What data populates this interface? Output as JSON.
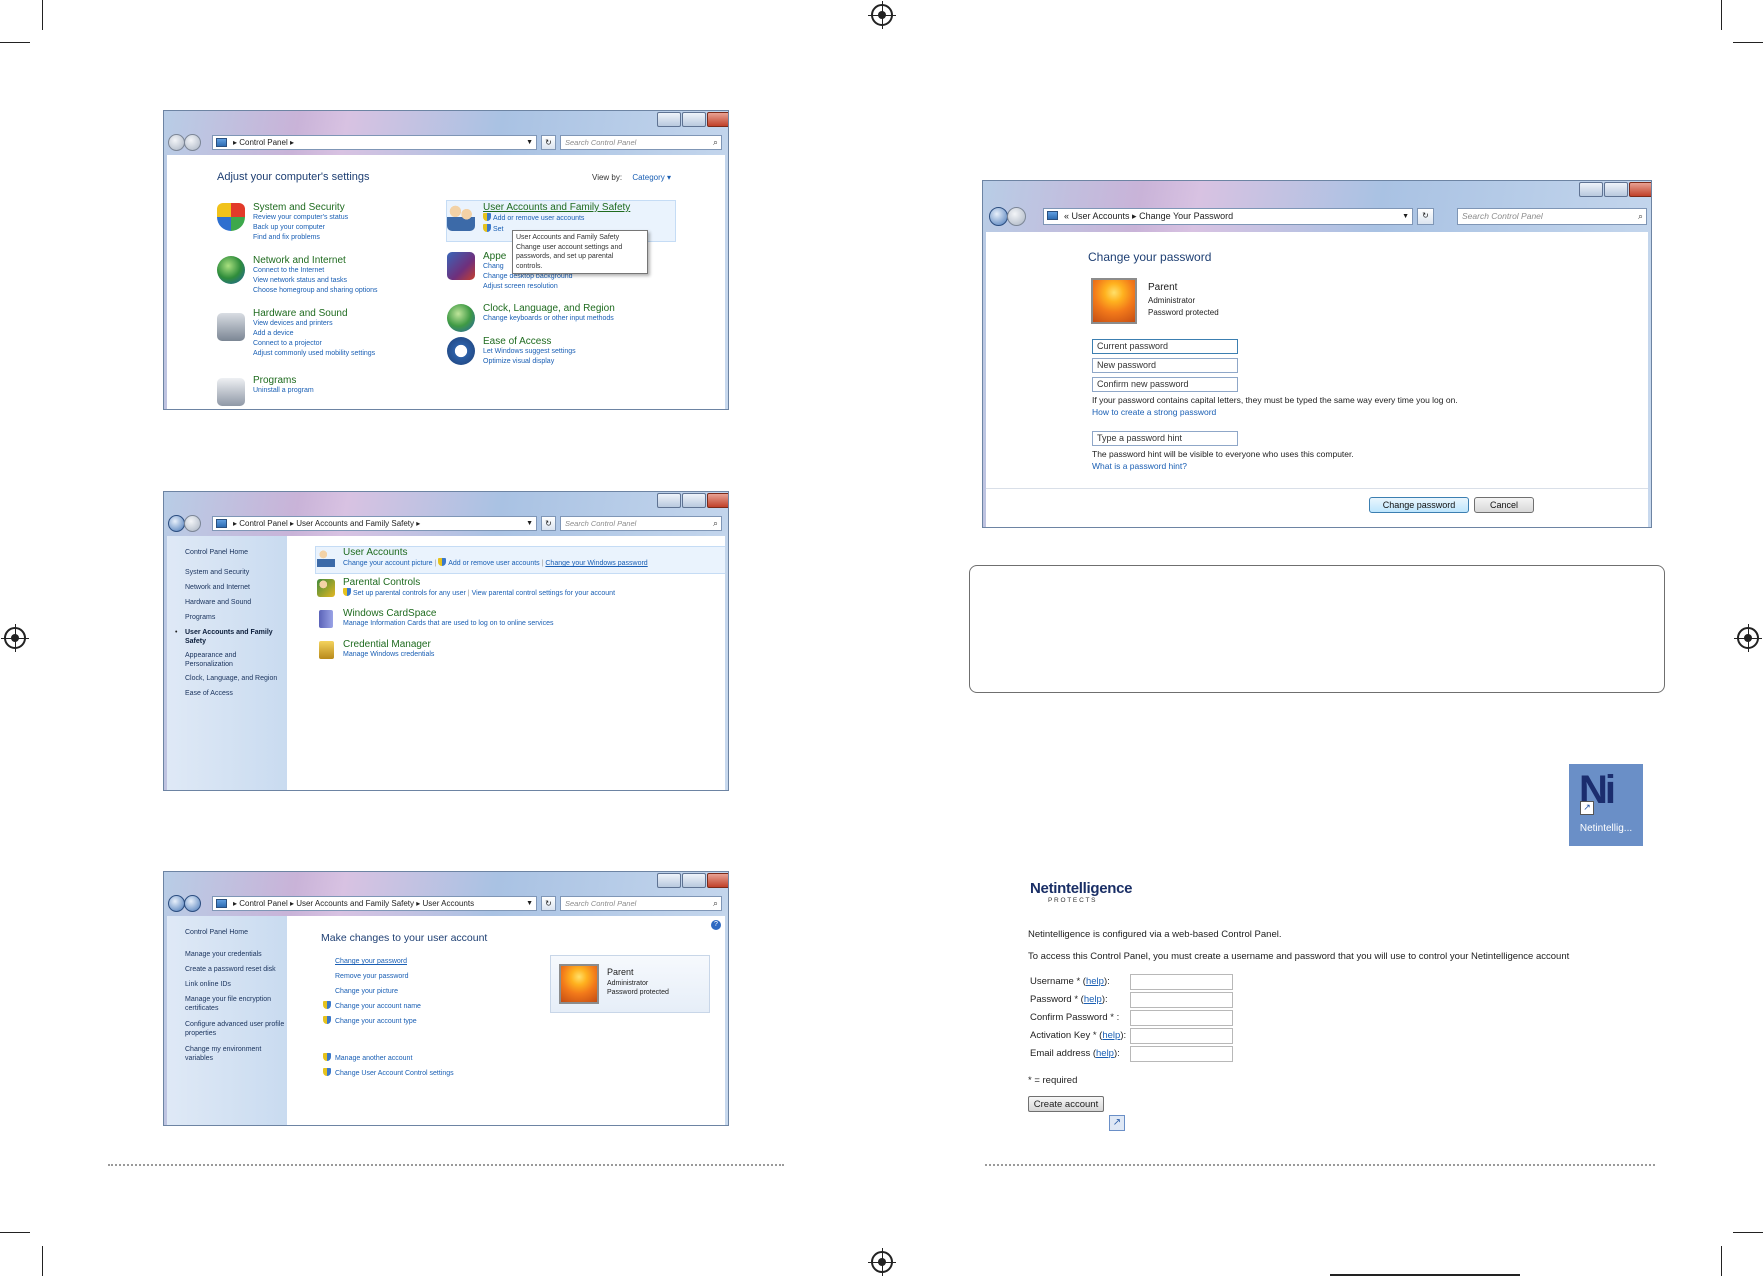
{
  "win1": {
    "address": {
      "crumbs": [
        "Control Panel"
      ]
    },
    "search_placeholder": "Search Control Panel",
    "heading": "Adjust your computer's settings",
    "view_by_label": "View by:",
    "view_by_value": "Category",
    "categories": [
      {
        "name": "System and Security",
        "links": [
          "Review your computer's status",
          "Back up your computer",
          "Find and fix problems"
        ]
      },
      {
        "name": "Network and Internet",
        "links": [
          "Connect to the Internet",
          "View network status and tasks",
          "Choose homegroup and sharing options"
        ]
      },
      {
        "name": "Hardware and Sound",
        "links": [
          "View devices and printers",
          "Add a device",
          "Connect to a projector",
          "Adjust commonly used mobility settings"
        ]
      },
      {
        "name": "Programs",
        "links": [
          "Uninstall a program"
        ]
      },
      {
        "name": "User Accounts and Family Safety",
        "links": [
          "Add or remove user accounts",
          "Set"
        ]
      },
      {
        "name": "Appe",
        "links": [
          "Chang",
          "Change desktop background",
          "Adjust screen resolution"
        ]
      },
      {
        "name": "Clock, Language, and Region",
        "links": [
          "Change keyboards or other input methods"
        ]
      },
      {
        "name": "Ease of Access",
        "links": [
          "Let Windows suggest settings",
          "Optimize visual display"
        ]
      }
    ],
    "tooltip": [
      "User Accounts and Family Safety",
      "Change user account settings and",
      "passwords, and set up parental",
      "controls."
    ]
  },
  "win2": {
    "address": {
      "crumbs": [
        "Control Panel",
        "User Accounts and Family Safety"
      ]
    },
    "search_placeholder": "Search Control Panel",
    "sidebar": [
      "Control Panel Home",
      "System and Security",
      "Network and Internet",
      "Hardware and Sound",
      "Programs",
      "User Accounts and Family Safety",
      "Appearance and Personalization",
      "Clock, Language, and Region",
      "Ease of Access"
    ],
    "sections": [
      {
        "name": "User Accounts",
        "links": [
          "Change your account picture",
          "Add or remove user accounts",
          "Change your Windows password"
        ]
      },
      {
        "name": "Parental Controls",
        "links": [
          "Set up parental controls for any user",
          "View parental control settings for your account"
        ]
      },
      {
        "name": "Windows CardSpace",
        "links": [
          "Manage Information Cards that are used to log on to online services"
        ]
      },
      {
        "name": "Credential Manager",
        "links": [
          "Manage Windows credentials"
        ]
      }
    ]
  },
  "win3": {
    "address": {
      "crumbs": [
        "Control Panel",
        "User Accounts and Family Safety",
        "User Accounts"
      ]
    },
    "search_placeholder": "Search Control Panel",
    "sidebar": [
      "Control Panel Home",
      "Manage your credentials",
      "Create a password reset disk",
      "Link online IDs",
      "Manage your file encryption certificates",
      "Configure advanced user profile properties",
      "Change my environment variables"
    ],
    "heading": "Make changes to your user account",
    "links": [
      "Change your password",
      "Remove your password",
      "Change your picture",
      "Change your account name",
      "Change your account type"
    ],
    "other_links": [
      "Manage another account",
      "Change User Account Control settings"
    ],
    "user": {
      "name": "Parent",
      "role": "Administrator",
      "status": "Password protected"
    }
  },
  "win4": {
    "address": {
      "crumbs": [
        "User Accounts",
        "Change Your Password"
      ]
    },
    "search_placeholder": "Search Control Panel",
    "heading": "Change your password",
    "user": {
      "name": "Parent",
      "role": "Administrator",
      "status": "Password protected"
    },
    "fields": {
      "current": "Current password",
      "new": "New password",
      "confirm": "Confirm new password",
      "hint": "Type a password hint"
    },
    "caps_note": "If your password contains capital letters, they must be typed the same way every time you log on.",
    "strong_link": "How to create a strong password",
    "hint_note": "The password hint will be visible to everyone who uses this computer.",
    "hint_link": "What is a password hint?",
    "change_button": "Change password",
    "cancel_button": "Cancel"
  },
  "desktop_icon": {
    "glyph": "Ni",
    "label": "Netintellig..."
  },
  "netintelligence": {
    "brand": "Netintelligence",
    "tagline": "P R O T E C T S",
    "intro": "Netintelligence is configured via a web-based Control Panel.",
    "instructions": "To access this Control Panel, you must create a username and password that you will use to control your Netintelligence account",
    "form": [
      {
        "label": "Username * (",
        "help": "help",
        "tail": "):"
      },
      {
        "label": "Password * (",
        "help": "help",
        "tail": "):"
      },
      {
        "label": "Confirm Password * :",
        "help": "",
        "tail": ""
      },
      {
        "label": "Activation Key * (",
        "help": "help",
        "tail": "):"
      },
      {
        "label": "Email address (",
        "help": "help",
        "tail": "):"
      }
    ],
    "required_note": "* = required",
    "create_button": "Create account"
  }
}
